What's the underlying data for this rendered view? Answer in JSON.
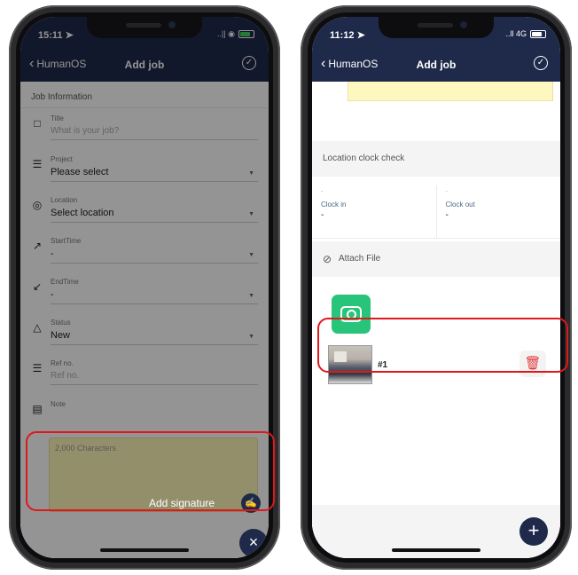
{
  "left": {
    "status": {
      "time": "15:11 ➤",
      "signal": "..|| ◉"
    },
    "nav": {
      "back_label": "HumanOS",
      "title": "Add job",
      "confirm_icon": "check-circle-icon"
    },
    "section_title": "Job Information",
    "fields": [
      {
        "icon": "□",
        "label": "Title",
        "value": "What is your job?",
        "placeholder": true,
        "dropdown": false
      },
      {
        "icon": "☰",
        "label": "Project",
        "value": "Please select",
        "placeholder": false,
        "dropdown": true
      },
      {
        "icon": "◎",
        "label": "Location",
        "value": "Select location",
        "placeholder": false,
        "dropdown": true
      },
      {
        "icon": "↗",
        "label": "StartTime",
        "value": "-",
        "placeholder": false,
        "dropdown": true
      },
      {
        "icon": "↙",
        "label": "EndTime",
        "value": "-",
        "placeholder": false,
        "dropdown": true
      },
      {
        "icon": "△",
        "label": "Status",
        "value": "New",
        "placeholder": false,
        "dropdown": true
      },
      {
        "icon": "☰",
        "label": "Ref no.",
        "value": "Ref no.",
        "placeholder": true,
        "dropdown": false
      },
      {
        "icon": "▤",
        "label": "Note",
        "value": "",
        "placeholder": false,
        "dropdown": false
      }
    ],
    "note_placeholder": "2,000 Characters",
    "signature_label": "Add signature",
    "signature_icon": "signature-pen-icon",
    "close_icon": "×"
  },
  "right": {
    "status": {
      "time": "11:12 ➤",
      "signal": "..ll 4G"
    },
    "nav": {
      "back_label": "HumanOS",
      "title": "Add job",
      "confirm_icon": "check-circle-icon"
    },
    "location_check_title": "Location clock check",
    "clock_in": {
      "top": "-",
      "label": "Clock in",
      "value": "-"
    },
    "clock_out": {
      "top": "-",
      "label": "Clock out",
      "value": "-"
    },
    "attach_label": "Attach File",
    "attachment": {
      "name": "#1"
    },
    "fab_icon": "+"
  },
  "colors": {
    "navbar": "#1f2a4a",
    "camera_button": "#28c47a",
    "highlight": "#e0171b",
    "delete": "#e23a3a"
  }
}
